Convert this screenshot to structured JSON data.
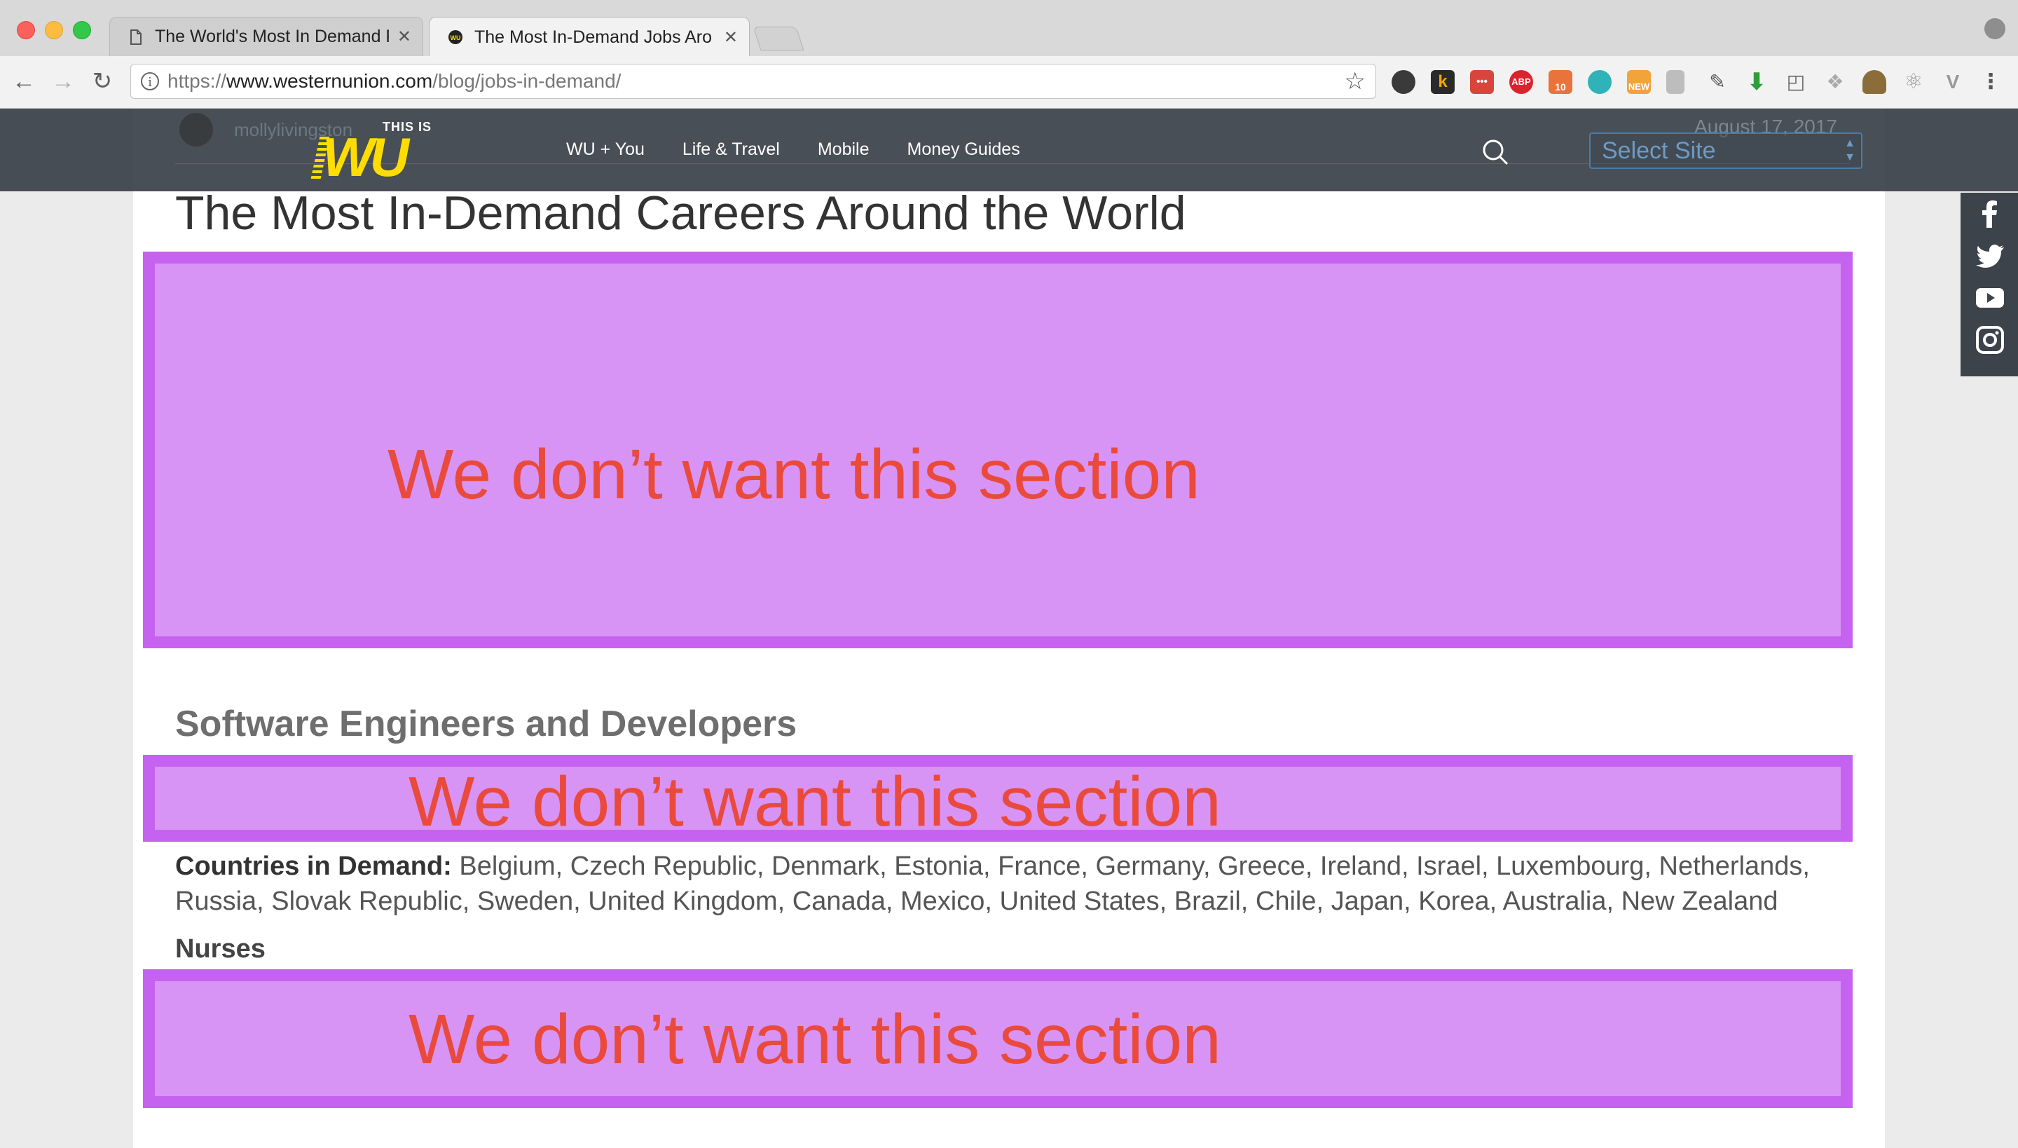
{
  "browser": {
    "tabs": [
      {
        "title": "The World's Most In Demand P",
        "active": false
      },
      {
        "title": "The Most In-Demand Jobs Aro",
        "active": true
      }
    ],
    "url_scheme": "https://",
    "url_domain": "www.westernunion.com",
    "url_path": "/blog/jobs-in-demand/",
    "extensions": {
      "k_label": "k",
      "abp_label": "ABP",
      "badge_10": "10",
      "new_label": "NEW"
    }
  },
  "site": {
    "author": "mollylivingston",
    "date": "August 17, 2017",
    "logo_small": "THIS IS",
    "logo_big": "WU",
    "nav": [
      "WU + You",
      "Life & Travel",
      "Mobile",
      "Money Guides"
    ],
    "select_site": "Select Site"
  },
  "article": {
    "title": "The Most In-Demand Careers Around the World",
    "overlay_text": "We don’t want this section",
    "section1_heading": "Software Engineers and Developers",
    "countries_label": "Countries in Demand:",
    "countries_list": "Belgium, Czech Republic, Denmark, Estonia, France, Germany, Greece, Ireland, Israel, Luxembourg, Netherlands, Russia, Slovak Republic, Sweden, United Kingdom, Canada, Mexico, United States, Brazil, Chile, Japan, Korea, Australia, New Zealand",
    "section2_heading": "Nurses"
  },
  "colors": {
    "overlay_fill": "#d894f4",
    "overlay_border": "#c562f0",
    "overlay_text": "#ea4a3c",
    "nav_bar": "#343c44",
    "logo_yellow": "#ffdd00"
  },
  "icons": [
    "back-icon",
    "forward-icon",
    "reload-icon",
    "info-icon",
    "star-icon",
    "search-icon",
    "facebook-icon",
    "twitter-icon",
    "youtube-icon",
    "instagram-icon",
    "profile-icon"
  ]
}
